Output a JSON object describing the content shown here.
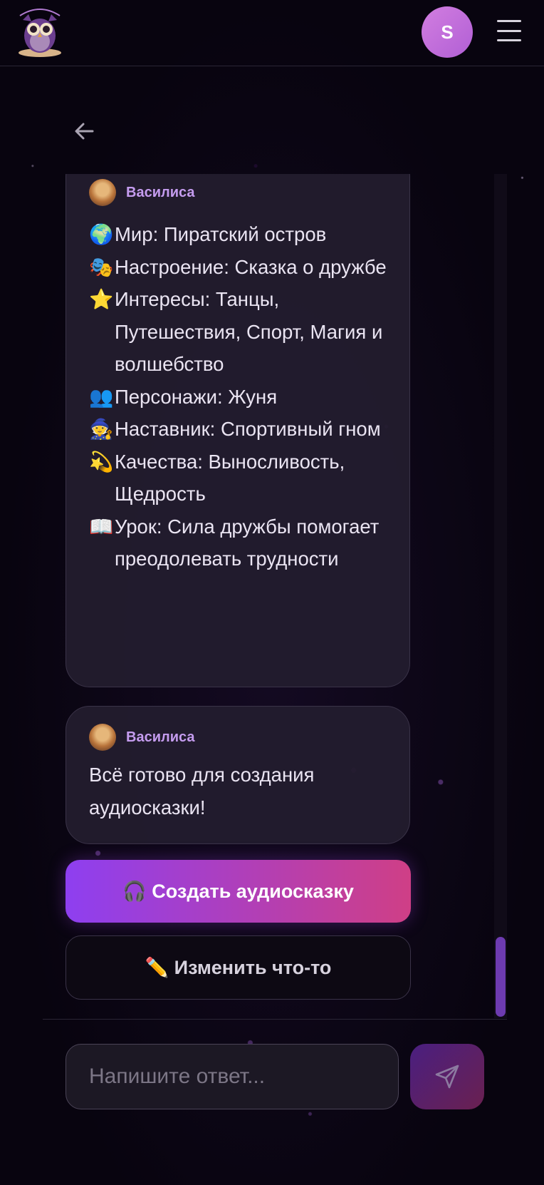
{
  "header": {
    "logo_alt": "owl-logo",
    "avatar_initial": "S",
    "menu_icon": "hamburger-icon"
  },
  "chat": {
    "messages": [
      {
        "sender": "Василиса",
        "lines": [
          {
            "emoji": "🌍",
            "text": "Мир: Пиратский остров"
          },
          {
            "emoji": "🎭",
            "text": "Настроение: Сказка о дружбе"
          },
          {
            "emoji": "⭐",
            "text": "Интересы: Танцы, Путешествия, Спорт, Магия и волшебство"
          },
          {
            "emoji": "👥",
            "text": "Персонажи: Жуня"
          },
          {
            "emoji": "🧙",
            "text": "Наставник: Спортивный гном"
          },
          {
            "emoji": "💫",
            "text": "Качества: Выносливость, Щедрость"
          },
          {
            "emoji": "📖",
            "text": "Урок: Сила дружбы помогает преодолевать трудности"
          }
        ]
      },
      {
        "sender": "Василиса",
        "text": "Всё готово для создания аудиосказки!"
      }
    ],
    "actions": {
      "create_label": "🎧 Создать аудиосказку",
      "edit_label": "✏️ Изменить что-то"
    }
  },
  "composer": {
    "placeholder": "Напишите ответ..."
  },
  "colors": {
    "accent_start": "#8e3ff0",
    "accent_end": "#cf3f86",
    "sender_name": "#c59cef"
  }
}
